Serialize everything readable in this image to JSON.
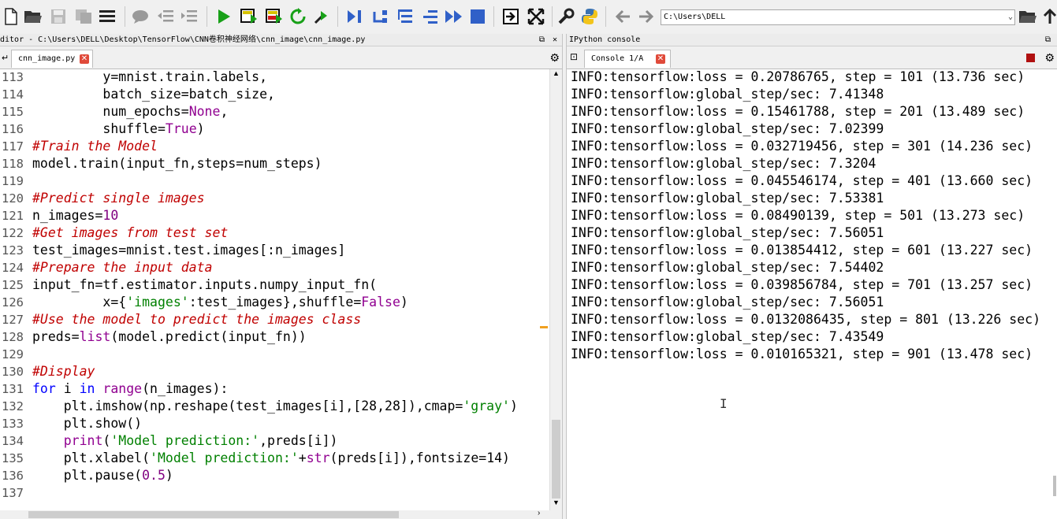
{
  "path": "C:\\Users\\DELL",
  "editor": {
    "title": "ditor - C:\\Users\\DELL\\Desktop\\TensorFlow\\CNN卷积神经网络\\cnn_image\\cnn_image.py",
    "tab": "cnn_image.py",
    "lines": [
      {
        "n": "113",
        "segs": [
          {
            "t": "         y=mnist.train.labels,",
            "c": ""
          }
        ]
      },
      {
        "n": "114",
        "segs": [
          {
            "t": "         batch_size=batch_size,",
            "c": ""
          }
        ]
      },
      {
        "n": "115",
        "segs": [
          {
            "t": "         num_epochs=",
            "c": ""
          },
          {
            "t": "None",
            "c": "bi"
          },
          {
            "t": ",",
            "c": ""
          }
        ]
      },
      {
        "n": "116",
        "segs": [
          {
            "t": "         shuffle=",
            "c": ""
          },
          {
            "t": "True",
            "c": "bi"
          },
          {
            "t": ")",
            "c": ""
          }
        ]
      },
      {
        "n": "117",
        "segs": [
          {
            "t": "#Train the Model",
            "c": "cm"
          }
        ]
      },
      {
        "n": "118",
        "segs": [
          {
            "t": "model.train(input_fn,steps=num_steps)",
            "c": ""
          }
        ]
      },
      {
        "n": "119",
        "segs": []
      },
      {
        "n": "120",
        "segs": [
          {
            "t": "#Predict single images",
            "c": "cm"
          }
        ]
      },
      {
        "n": "121",
        "segs": [
          {
            "t": "n_images=",
            "c": ""
          },
          {
            "t": "10",
            "c": "nm"
          }
        ]
      },
      {
        "n": "122",
        "segs": [
          {
            "t": "#Get images from test set",
            "c": "cm"
          }
        ]
      },
      {
        "n": "123",
        "segs": [
          {
            "t": "test_images=mnist.test.images[:n_images]",
            "c": ""
          }
        ]
      },
      {
        "n": "124",
        "segs": [
          {
            "t": "#Prepare the input data",
            "c": "cm"
          }
        ]
      },
      {
        "n": "125",
        "segs": [
          {
            "t": "input_fn=tf.estimator.inputs.numpy_input_fn(",
            "c": ""
          }
        ]
      },
      {
        "n": "126",
        "segs": [
          {
            "t": "         x={",
            "c": ""
          },
          {
            "t": "'images'",
            "c": "st"
          },
          {
            "t": ":test_images},shuffle=",
            "c": ""
          },
          {
            "t": "False",
            "c": "bi"
          },
          {
            "t": ")",
            "c": ""
          }
        ]
      },
      {
        "n": "127",
        "segs": [
          {
            "t": "#Use the model to predict the images class",
            "c": "cm"
          }
        ]
      },
      {
        "n": "128",
        "segs": [
          {
            "t": "preds=",
            "c": ""
          },
          {
            "t": "list",
            "c": "bi"
          },
          {
            "t": "(model.predict(input_fn))",
            "c": ""
          }
        ]
      },
      {
        "n": "129",
        "segs": []
      },
      {
        "n": "130",
        "segs": [
          {
            "t": "#Display",
            "c": "cm"
          }
        ]
      },
      {
        "n": "131",
        "segs": [
          {
            "t": "for",
            "c": "kw"
          },
          {
            "t": " i ",
            "c": ""
          },
          {
            "t": "in",
            "c": "kw"
          },
          {
            "t": " ",
            "c": ""
          },
          {
            "t": "range",
            "c": "bi"
          },
          {
            "t": "(n_images):",
            "c": ""
          }
        ]
      },
      {
        "n": "132",
        "segs": [
          {
            "t": "    plt.imshow(np.reshape(test_images[i],[28,28]),cmap=",
            "c": ""
          },
          {
            "t": "'gray'",
            "c": "st"
          },
          {
            "t": ")",
            "c": ""
          }
        ]
      },
      {
        "n": "133",
        "segs": [
          {
            "t": "    plt.show()",
            "c": ""
          }
        ]
      },
      {
        "n": "134",
        "segs": [
          {
            "t": "    ",
            "c": ""
          },
          {
            "t": "print",
            "c": "bi"
          },
          {
            "t": "(",
            "c": ""
          },
          {
            "t": "'Model prediction:'",
            "c": "st"
          },
          {
            "t": ",preds[i])",
            "c": ""
          }
        ]
      },
      {
        "n": "135",
        "segs": [
          {
            "t": "    plt.xlabel(",
            "c": ""
          },
          {
            "t": "'Model prediction:'",
            "c": "st"
          },
          {
            "t": "+",
            "c": ""
          },
          {
            "t": "str",
            "c": "bi"
          },
          {
            "t": "(preds[i]),fontsize=14)",
            "c": ""
          }
        ]
      },
      {
        "n": "136",
        "segs": [
          {
            "t": "    plt.pause(",
            "c": ""
          },
          {
            "t": "0.5",
            "c": "nm"
          },
          {
            "t": ")",
            "c": ""
          }
        ]
      },
      {
        "n": "137",
        "segs": []
      }
    ]
  },
  "console": {
    "title": "IPython console",
    "tab": "Console 1/A",
    "lines": [
      "INFO:tensorflow:loss = 0.20786765, step = 101 (13.736 sec)",
      "INFO:tensorflow:global_step/sec: 7.41348",
      "INFO:tensorflow:loss = 0.15461788, step = 201 (13.489 sec)",
      "INFO:tensorflow:global_step/sec: 7.02399",
      "INFO:tensorflow:loss = 0.032719456, step = 301 (14.236 sec)",
      "INFO:tensorflow:global_step/sec: 7.3204",
      "INFO:tensorflow:loss = 0.045546174, step = 401 (13.660 sec)",
      "INFO:tensorflow:global_step/sec: 7.53381",
      "INFO:tensorflow:loss = 0.08490139, step = 501 (13.273 sec)",
      "INFO:tensorflow:global_step/sec: 7.56051",
      "INFO:tensorflow:loss = 0.013854412, step = 601 (13.227 sec)",
      "INFO:tensorflow:global_step/sec: 7.54402",
      "INFO:tensorflow:loss = 0.039856784, step = 701 (13.257 sec)",
      "INFO:tensorflow:global_step/sec: 7.56051",
      "INFO:tensorflow:loss = 0.0132086435, step = 801 (13.226 sec)",
      "INFO:tensorflow:global_step/sec: 7.43549",
      "INFO:tensorflow:loss = 0.010165321, step = 901 (13.478 sec)"
    ]
  },
  "colors": {
    "run": "#18a018",
    "stop": "#3060c8",
    "tab_close": "#e04a3a",
    "comment": "#c00000",
    "string": "#008000",
    "builtin": "#900090",
    "keyword": "#0000ff"
  }
}
